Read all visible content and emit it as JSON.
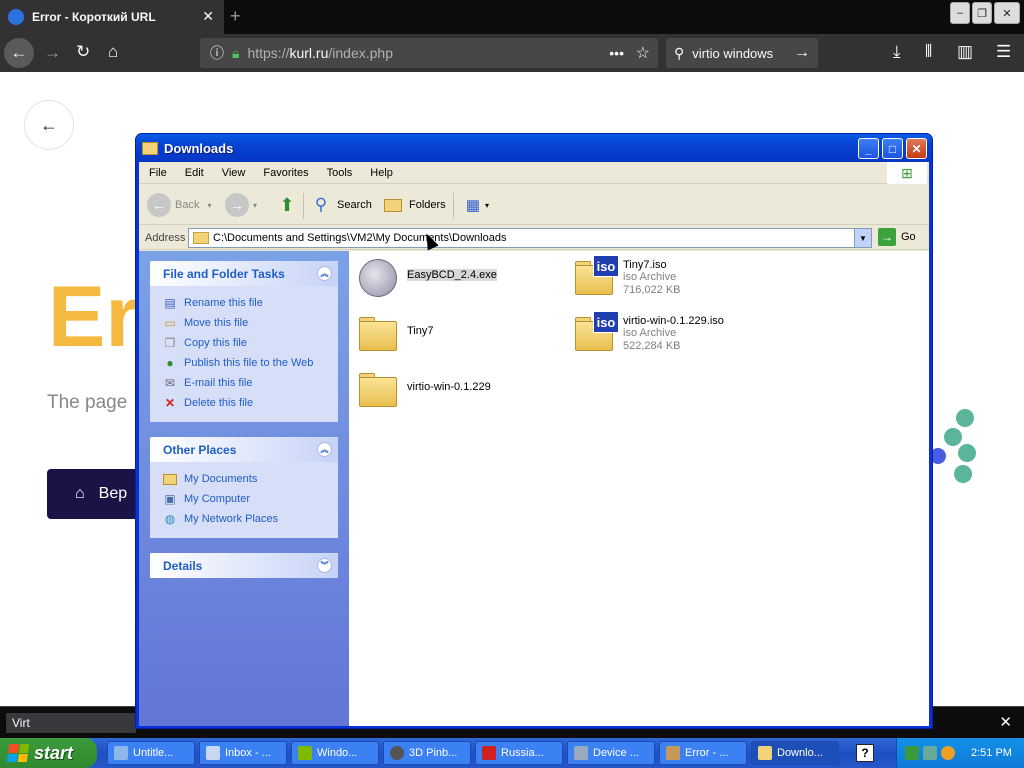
{
  "firefox": {
    "tab_title": "Error - Короткий URL",
    "url_prefix": "https://",
    "url_domain": "kurl.ru",
    "url_path": "/index.php",
    "search_query": "virtio windows",
    "find_text": "Virt"
  },
  "webpage": {
    "error_heading": "Er",
    "error_text": "The page",
    "button_label": "Вер"
  },
  "explorer": {
    "title": "Downloads",
    "menu": [
      "File",
      "Edit",
      "View",
      "Favorites",
      "Tools",
      "Help"
    ],
    "toolbar": {
      "back": "Back",
      "search": "Search",
      "folders": "Folders"
    },
    "address_label": "Address",
    "address_value": "C:\\Documents and Settings\\VM2\\My Documents\\Downloads",
    "go_label": "Go",
    "file_tasks": {
      "title": "File and Folder Tasks",
      "items": [
        "Rename this file",
        "Move this file",
        "Copy this file",
        "Publish this file to the Web",
        "E-mail this file",
        "Delete this file"
      ]
    },
    "other_places": {
      "title": "Other Places",
      "items": [
        "My Documents",
        "My Computer",
        "My Network Places"
      ]
    },
    "details_title": "Details",
    "files": [
      {
        "name": "EasyBCD_2.4.exe",
        "type": "",
        "size": ""
      },
      {
        "name": "Tiny7.iso",
        "type": "iso Archive",
        "size": "716,022 KB"
      },
      {
        "name": "Tiny7",
        "type": "",
        "size": ""
      },
      {
        "name": "virtio-win-0.1.229.iso",
        "type": "iso Archive",
        "size": "522,284 KB"
      },
      {
        "name": "virtio-win-0.1.229",
        "type": "",
        "size": ""
      }
    ]
  },
  "taskbar": {
    "start_label": "start",
    "buttons": [
      "Untitle...",
      "Inbox - ...",
      "Windo...",
      "3D Pinb...",
      "Russia...",
      "Device ...",
      "Error - ...",
      "Downlo..."
    ],
    "help": "?",
    "clock": "2:51 PM"
  },
  "colors": {
    "xp_blue": "#0831d9",
    "firefox_dark": "#323234",
    "error_orange": "#f6b940",
    "button_navy": "#1a1446"
  }
}
